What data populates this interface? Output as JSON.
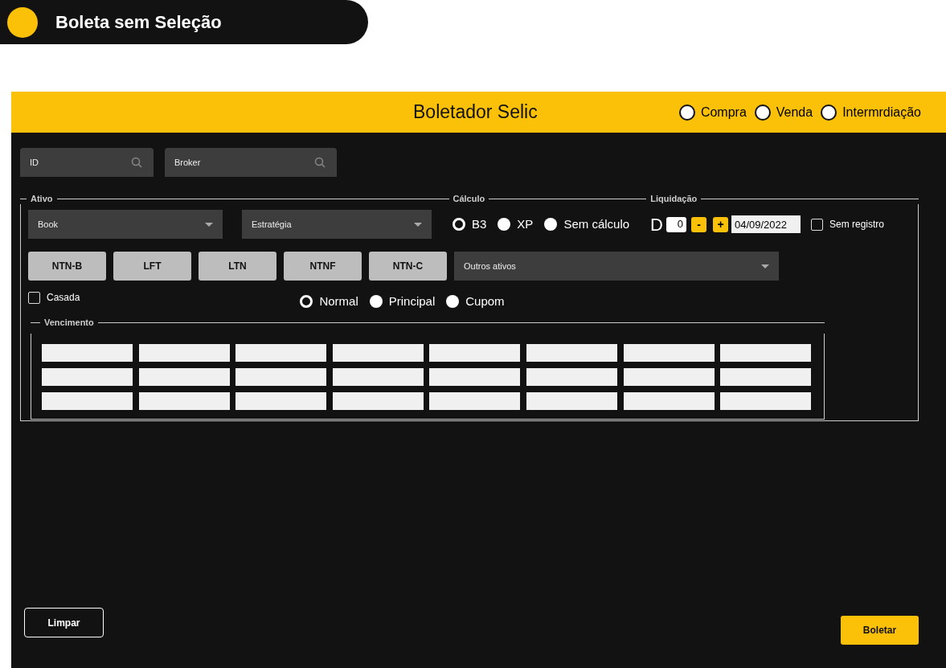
{
  "screen_tag": {
    "label": "Boleta sem Seleção",
    "color": "#fbc108"
  },
  "header": {
    "title": "Boletador Selic",
    "operations": [
      {
        "label": "Compra",
        "selected": false
      },
      {
        "label": "Venda",
        "selected": false
      },
      {
        "label": "Intermrdiação",
        "selected": false
      }
    ]
  },
  "search_fields": [
    {
      "placeholder": "ID"
    },
    {
      "placeholder": "Broker"
    }
  ],
  "sections": {
    "ativo": "Ativo",
    "calculo": "Cálculo",
    "liquidacao": "Liquidação"
  },
  "book": {
    "placeholder": "Book"
  },
  "estrategia": {
    "placeholder": "Estratégia"
  },
  "calculo": [
    {
      "label": "B3",
      "selected": true
    },
    {
      "label": "XP",
      "selected": false
    },
    {
      "label": "Sem cálculo",
      "selected": false
    }
  ],
  "liquidacao": {
    "prefix": "D",
    "days": "0",
    "minus": "-",
    "plus": "+",
    "date": "04/09/2022",
    "sem_registro": {
      "label": "Sem registro",
      "checked": false
    }
  },
  "assets": [
    {
      "label": "NTN-B",
      "selected": false
    },
    {
      "label": "LFT",
      "selected": false
    },
    {
      "label": "LTN",
      "selected": false
    },
    {
      "label": "NTNF",
      "selected": false
    },
    {
      "label": "NTN-C",
      "selected": false
    }
  ],
  "outros_ativos": {
    "placeholder": "Outros ativos"
  },
  "casada": {
    "label": "Casada",
    "checked": false
  },
  "modes": [
    {
      "label": "Normal",
      "selected": true
    },
    {
      "label": "Principal",
      "selected": false
    },
    {
      "label": "Cupom",
      "selected": false
    }
  ],
  "vencimento": {
    "label": "Vencimento",
    "rows": [
      [
        {
          "selected": false
        },
        {
          "selected": false
        },
        {
          "selected": false
        },
        {
          "selected": false
        },
        {
          "selected": false
        },
        {
          "selected": false
        },
        {
          "selected": false
        },
        {
          "selected": false
        }
      ],
      [
        {
          "selected": false
        },
        {
          "selected": false
        },
        {
          "selected": false
        },
        {
          "selected": false
        },
        {
          "selected": false
        },
        {
          "selected": false
        },
        {
          "selected": false
        },
        {
          "selected": false
        }
      ],
      [
        {
          "selected": false
        },
        {
          "selected": false
        },
        {
          "selected": false
        },
        {
          "selected": false
        },
        {
          "selected": false
        },
        {
          "selected": false
        },
        {
          "selected": false
        },
        {
          "selected": false
        }
      ]
    ]
  },
  "buttons": {
    "clear": "Limpar",
    "submit": "Boletar"
  }
}
